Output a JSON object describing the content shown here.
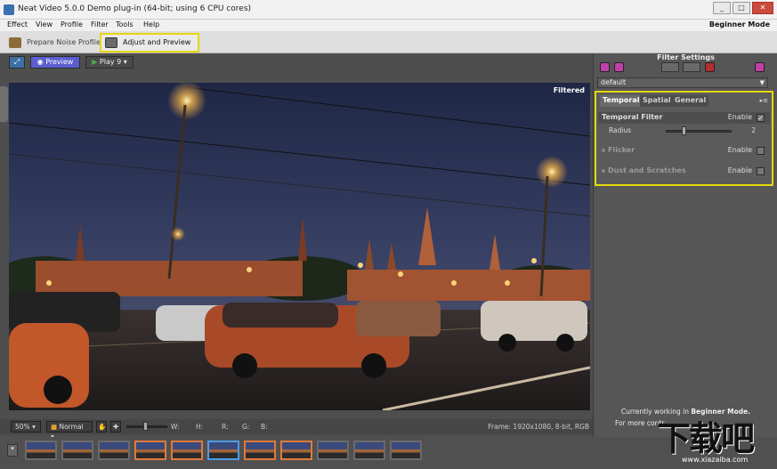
{
  "window": {
    "title": "Neat Video 5.0.0 Demo plug-in (64-bit; using 6 CPU cores)",
    "controls": [
      "_",
      "□",
      "✕"
    ]
  },
  "menu": {
    "items": [
      "Effect",
      "View",
      "Profile",
      "Filter",
      "Tools",
      "Help"
    ],
    "mode": "Beginner Mode"
  },
  "steps": {
    "prepare": "Prepare Noise Profile",
    "adjust": "Adjust and Preview"
  },
  "toolbar": {
    "preview": "Preview",
    "play": "Play",
    "play_count": "9"
  },
  "viewer": {
    "overlay": "Filtered"
  },
  "status": {
    "zoom": "50%",
    "quality": "Normal",
    "w_label": "W:",
    "h_label": "H:",
    "r_label": "R:",
    "g_label": "G:",
    "b_label": "B:",
    "frame_info": "Frame: 1920x1080, 8-bit, RGB"
  },
  "filter_settings": {
    "title": "Filter Settings",
    "preset": "default",
    "tabs": [
      "Temporal",
      "Spatial",
      "General"
    ],
    "temporal_filter": {
      "name": "Temporal Filter",
      "enable_label": "Enable",
      "checked": true
    },
    "radius": {
      "label": "Radius",
      "value": "2"
    },
    "flicker": {
      "name": "Flicker",
      "enable_label": "Enable"
    },
    "dust": {
      "name": "Dust and Scratches",
      "enable_label": "Enable"
    }
  },
  "footer": {
    "working": "Currently working in",
    "mode": "Beginner Mode.",
    "more": "For more contr"
  },
  "watermark": {
    "text": "下载吧",
    "url": "www.xiazaiba.com"
  },
  "colors": {
    "highlight": "#e6d80c",
    "preview_btn": "#5a5ecf",
    "thumb_selected": "#e07a3c"
  }
}
